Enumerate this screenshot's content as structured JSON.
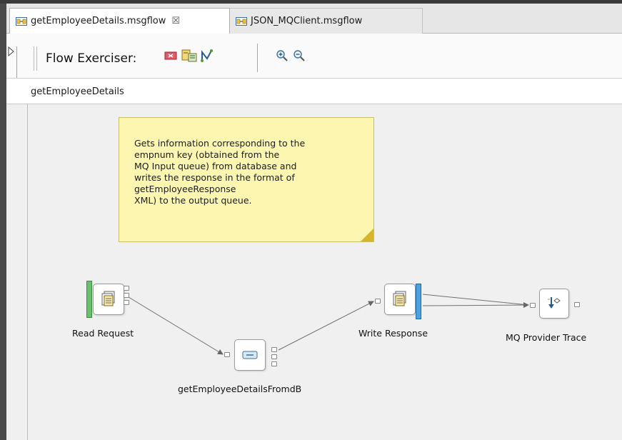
{
  "tabs": [
    {
      "label": "getEmployeeDetails.msgflow",
      "active": true,
      "close_glyph": "☒"
    },
    {
      "label": "JSON_MQClient.msgflow",
      "active": false
    }
  ],
  "toolbar": {
    "flow_exerciser_label": "Flow Exerciser:",
    "buttons": [
      "stop-recording-icon",
      "view-recorded-message-icon",
      "send-message-icon",
      "zoom-in-icon",
      "zoom-out-icon"
    ]
  },
  "breadcrumb": {
    "path": "getEmployeeDetails"
  },
  "note": {
    "text": "Gets information corresponding to the\nempnum key (obtained from the\nMQ Input queue) from database and\nwrites the response in the format of\ngetEmployeeResponse\nXML) to the output queue."
  },
  "nodes": [
    {
      "id": "read-request",
      "label": "Read Request",
      "icon": "mq-input-icon"
    },
    {
      "id": "get-details",
      "label": "getEmployeeDetailsFromdB",
      "icon": "compute-icon"
    },
    {
      "id": "write-response",
      "label": "Write Response",
      "icon": "mq-output-icon"
    },
    {
      "id": "mq-trace",
      "label": "MQ Provider Trace",
      "icon": "trace-icon"
    }
  ],
  "colors": {
    "note_fill": "#fdf6b0",
    "canvas": "#f0f0f0",
    "input_bar": "#6cbf6c",
    "output_bar": "#4aa3e0"
  }
}
